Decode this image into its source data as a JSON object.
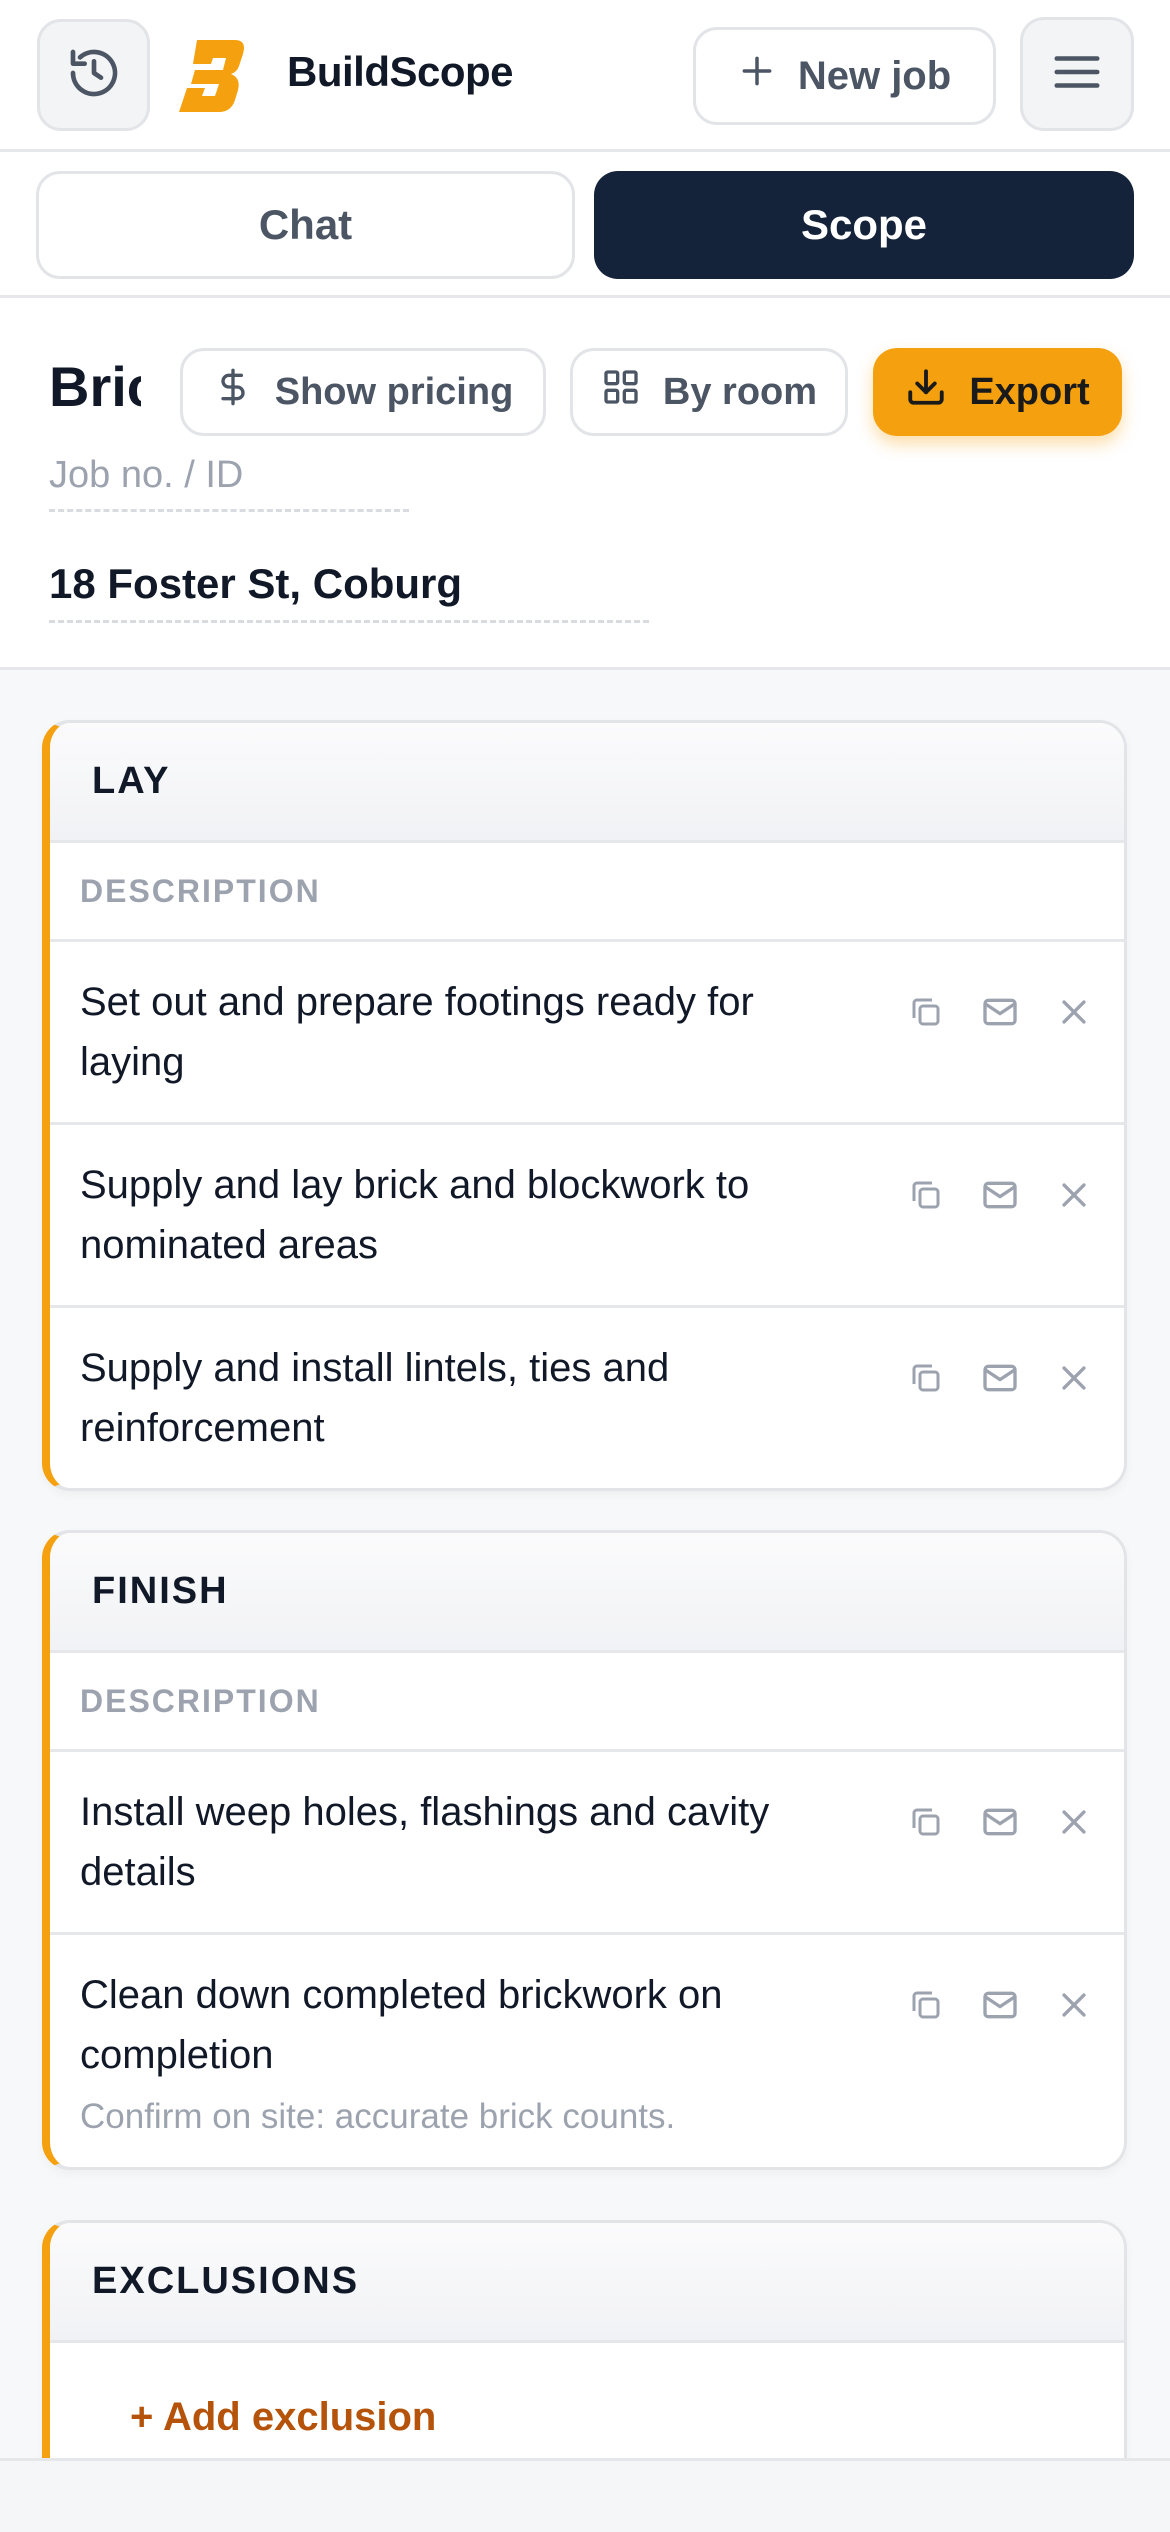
{
  "header": {
    "brand": "BuildScope",
    "new_job_label": "New job",
    "accent": "#f5a00f"
  },
  "tabs": [
    {
      "label": "Chat",
      "active": false
    },
    {
      "label": "Scope",
      "active": true
    }
  ],
  "job": {
    "title": "Bric",
    "job_no_placeholder": "Job no. / ID",
    "address": "18 Foster St, Coburg",
    "show_pricing_label": "Show pricing",
    "by_room_label": "By room",
    "export_label": "Export"
  },
  "sections": [
    {
      "title": "LAY",
      "column_header": "DESCRIPTION",
      "items": [
        {
          "text": "Set out and prepare footings ready for laying"
        },
        {
          "text": "Supply and lay brick and blockwork to nominated areas"
        },
        {
          "text": "Supply and install lintels, ties and reinforcement"
        }
      ]
    },
    {
      "title": "FINISH",
      "column_header": "DESCRIPTION",
      "items": [
        {
          "text": "Install weep holes, flashings and cavity details"
        },
        {
          "text": "Clean down completed brickwork on completion",
          "note": "Confirm on site: accurate brick counts."
        }
      ]
    }
  ],
  "exclusions": {
    "title": "EXCLUSIONS",
    "add_label": "+ Add exclusion"
  },
  "icons": {
    "history": "history-icon",
    "logo": "buildscope-logo",
    "plus": "plus-icon",
    "menu": "hamburger-menu-icon",
    "dollar": "dollar-icon",
    "grid": "grid-icon",
    "download": "download-icon",
    "copy": "copy-icon",
    "mail": "mail-icon",
    "close": "close-icon"
  }
}
